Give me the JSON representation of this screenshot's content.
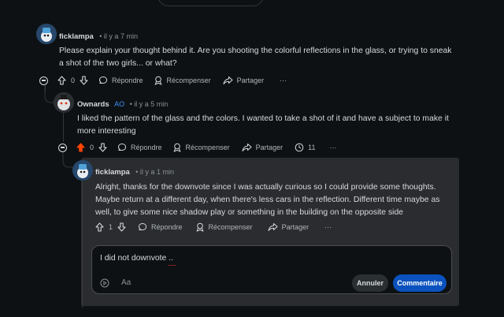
{
  "comments": [
    {
      "username": "ficklampa",
      "time": "• il y a 7 min",
      "text": "Please explain your thought behind it. Are you shooting the colorful reflections in the glass, or trying to sneak a shot of the two girls... or what?",
      "score": "0",
      "reply_label": "Répondre",
      "award_label": "Récompenser",
      "share_label": "Partager",
      "more_label": "···"
    },
    {
      "username": "Ownards",
      "op_badge": "AO",
      "time": "• il y a 5 min",
      "text": "I liked the pattern of the glass and the colors. I wanted to take a shot of it and have a subject to make it more interesting",
      "score": "0",
      "upvoted": true,
      "reply_label": "Répondre",
      "award_label": "Récompenser",
      "share_label": "Partager",
      "insights_count": "11",
      "more_label": "···"
    },
    {
      "username": "ficklampa",
      "time": "• il y a 1 min",
      "text": "Alright, thanks for the downvote since I was actually curious so I could provide some thoughts. Maybe return at a different day, when there's less cars in the reflection. Different time maybe as well, to give some nice shadow play or something in the building on the opposite side",
      "score": "1",
      "reply_label": "Répondre",
      "award_label": "Récompenser",
      "share_label": "Partager",
      "more_label": "···"
    }
  ],
  "reply_editor": {
    "value": "I did not downvote ..",
    "format_label": "Aa",
    "cancel_label": "Annuler",
    "submit_label": "Commentaire"
  },
  "colors": {
    "background": "#0e1113",
    "panel": "#2a2c2f",
    "upvote_active": "#ff4500",
    "op_badge": "#3a8fff",
    "submit_button": "#0b52be"
  }
}
